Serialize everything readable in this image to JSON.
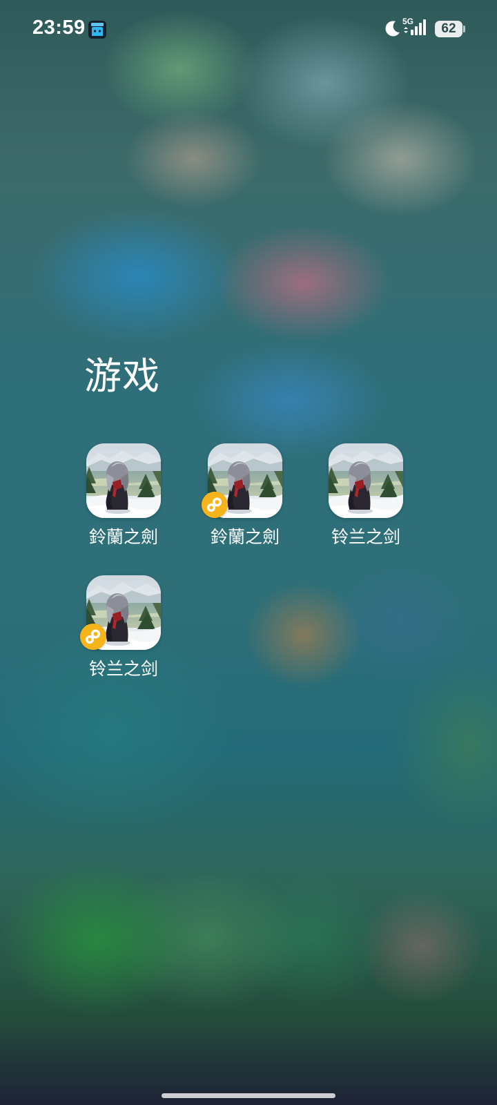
{
  "status_bar": {
    "time": "23:59",
    "network_type": "5G",
    "battery_level": "62",
    "notification_app_icon": "bilibili-icon",
    "dnd_icon": "moon-icon",
    "signal_icon": "cellular-signal-icon"
  },
  "folder": {
    "title": "游戏",
    "apps": [
      {
        "label": "鈴蘭之劍",
        "icon": "sword-of-convallaria-icon",
        "clone_badge": false
      },
      {
        "label": "鈴蘭之劍",
        "icon": "sword-of-convallaria-icon",
        "clone_badge": true,
        "badge_icon": "app-clone-badge-icon"
      },
      {
        "label": "铃兰之剑",
        "icon": "sword-of-convallaria-icon",
        "clone_badge": false
      },
      {
        "label": "铃兰之剑",
        "icon": "sword-of-convallaria-icon",
        "clone_badge": true,
        "badge_icon": "app-clone-badge-icon"
      }
    ]
  },
  "colors": {
    "badge": "#f4b41a",
    "text": "#ffffff"
  }
}
